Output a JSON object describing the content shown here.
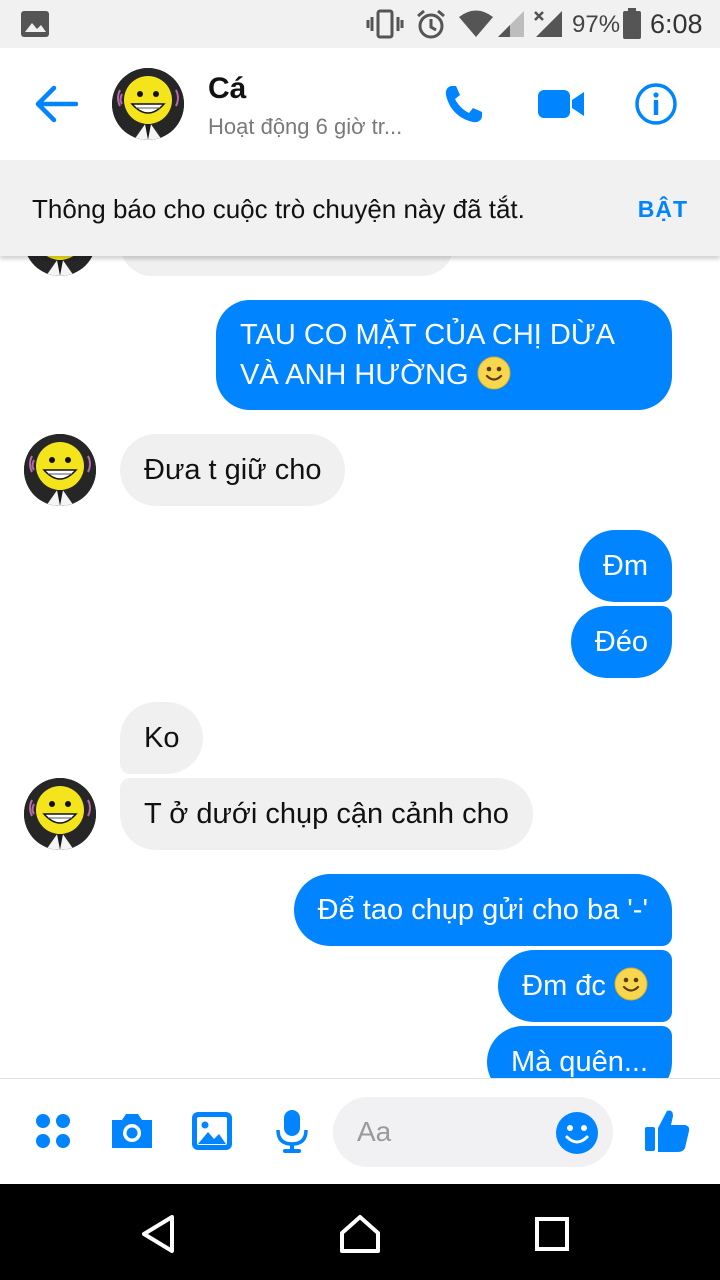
{
  "status_bar": {
    "battery_percent": "97%",
    "time": "6:08"
  },
  "header": {
    "name": "Cá",
    "subtitle": "Hoạt động 6 giờ tr..."
  },
  "banner": {
    "text": "Thông báo cho cuộc trò chuyện này đã tắt.",
    "action": "BẬT"
  },
  "messages": [
    {
      "from": "me",
      "lines": [
        "TAU CO MẶT CỦA CHỊ DỪA",
        "VÀ ANH HƯỜNG"
      ],
      "emoji": "slightly-smiling-face"
    },
    {
      "from": "them",
      "text": "Đưa t giữ cho"
    },
    {
      "from": "me",
      "text": "Đm"
    },
    {
      "from": "me",
      "text": "Đéo"
    },
    {
      "from": "them",
      "text": "Ko"
    },
    {
      "from": "them",
      "text": "T ở dưới chụp cận cảnh cho"
    },
    {
      "from": "me",
      "text": "Để tao chụp gửi cho ba '-'"
    },
    {
      "from": "me",
      "text": "Đm đc",
      "emoji": "slightly-smiling-face"
    },
    {
      "from": "me",
      "text": "Mà quên..."
    }
  ],
  "composer": {
    "placeholder": "Aa"
  },
  "icons": {
    "header": [
      "back-arrow-icon",
      "phone-icon",
      "video-camera-icon",
      "info-icon"
    ],
    "composer": [
      "more-dots-icon",
      "camera-icon",
      "gallery-icon",
      "microphone-icon",
      "emoji-icon",
      "thumbs-up-icon"
    ],
    "navigation": [
      "back-triangle-icon",
      "home-icon",
      "recents-square-icon"
    ]
  },
  "colors": {
    "accent": "#0084ff",
    "incoming_bubble": "#f1f0f0",
    "outgoing_text": "#ffffff"
  }
}
